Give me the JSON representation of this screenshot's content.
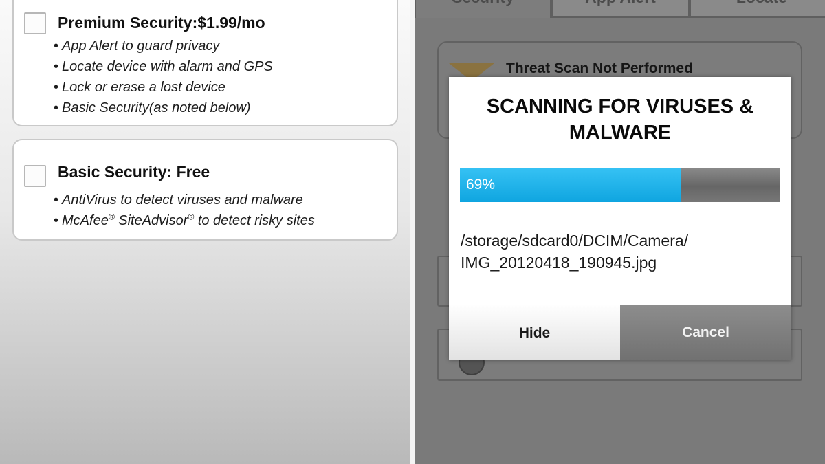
{
  "left": {
    "plans": [
      {
        "title": "Premium Security:$1.99/mo",
        "checked": false,
        "features": [
          "App Alert to guard privacy",
          "Locate device with alarm and GPS",
          "Lock or erase a lost device",
          "Basic Security(as noted below)"
        ]
      },
      {
        "title": "Basic Security: Free",
        "checked": false,
        "features": [
          "AntiVirus to detect viruses and malware",
          "McAfee",
          "SiteAdvisor",
          "to detect risky sites"
        ],
        "registered_mark": "®"
      }
    ]
  },
  "right": {
    "tabs": [
      "Security",
      "App Alert",
      "Locate"
    ],
    "threat_title": "Threat Scan Not Performed"
  },
  "dialog": {
    "title": "SCANNING FOR VIRUSES & MALWARE",
    "progress_percent": 69,
    "progress_label": "69%",
    "file_path_line1": "/storage/sdcard0/DCIM/Camera/",
    "file_path_line2": "IMG_20120418_190945.jpg",
    "hide_label": "Hide",
    "cancel_label": "Cancel"
  },
  "colors": {
    "progress_fill": "#1ab1ea",
    "overlay_gray": "#7a7a7a"
  }
}
